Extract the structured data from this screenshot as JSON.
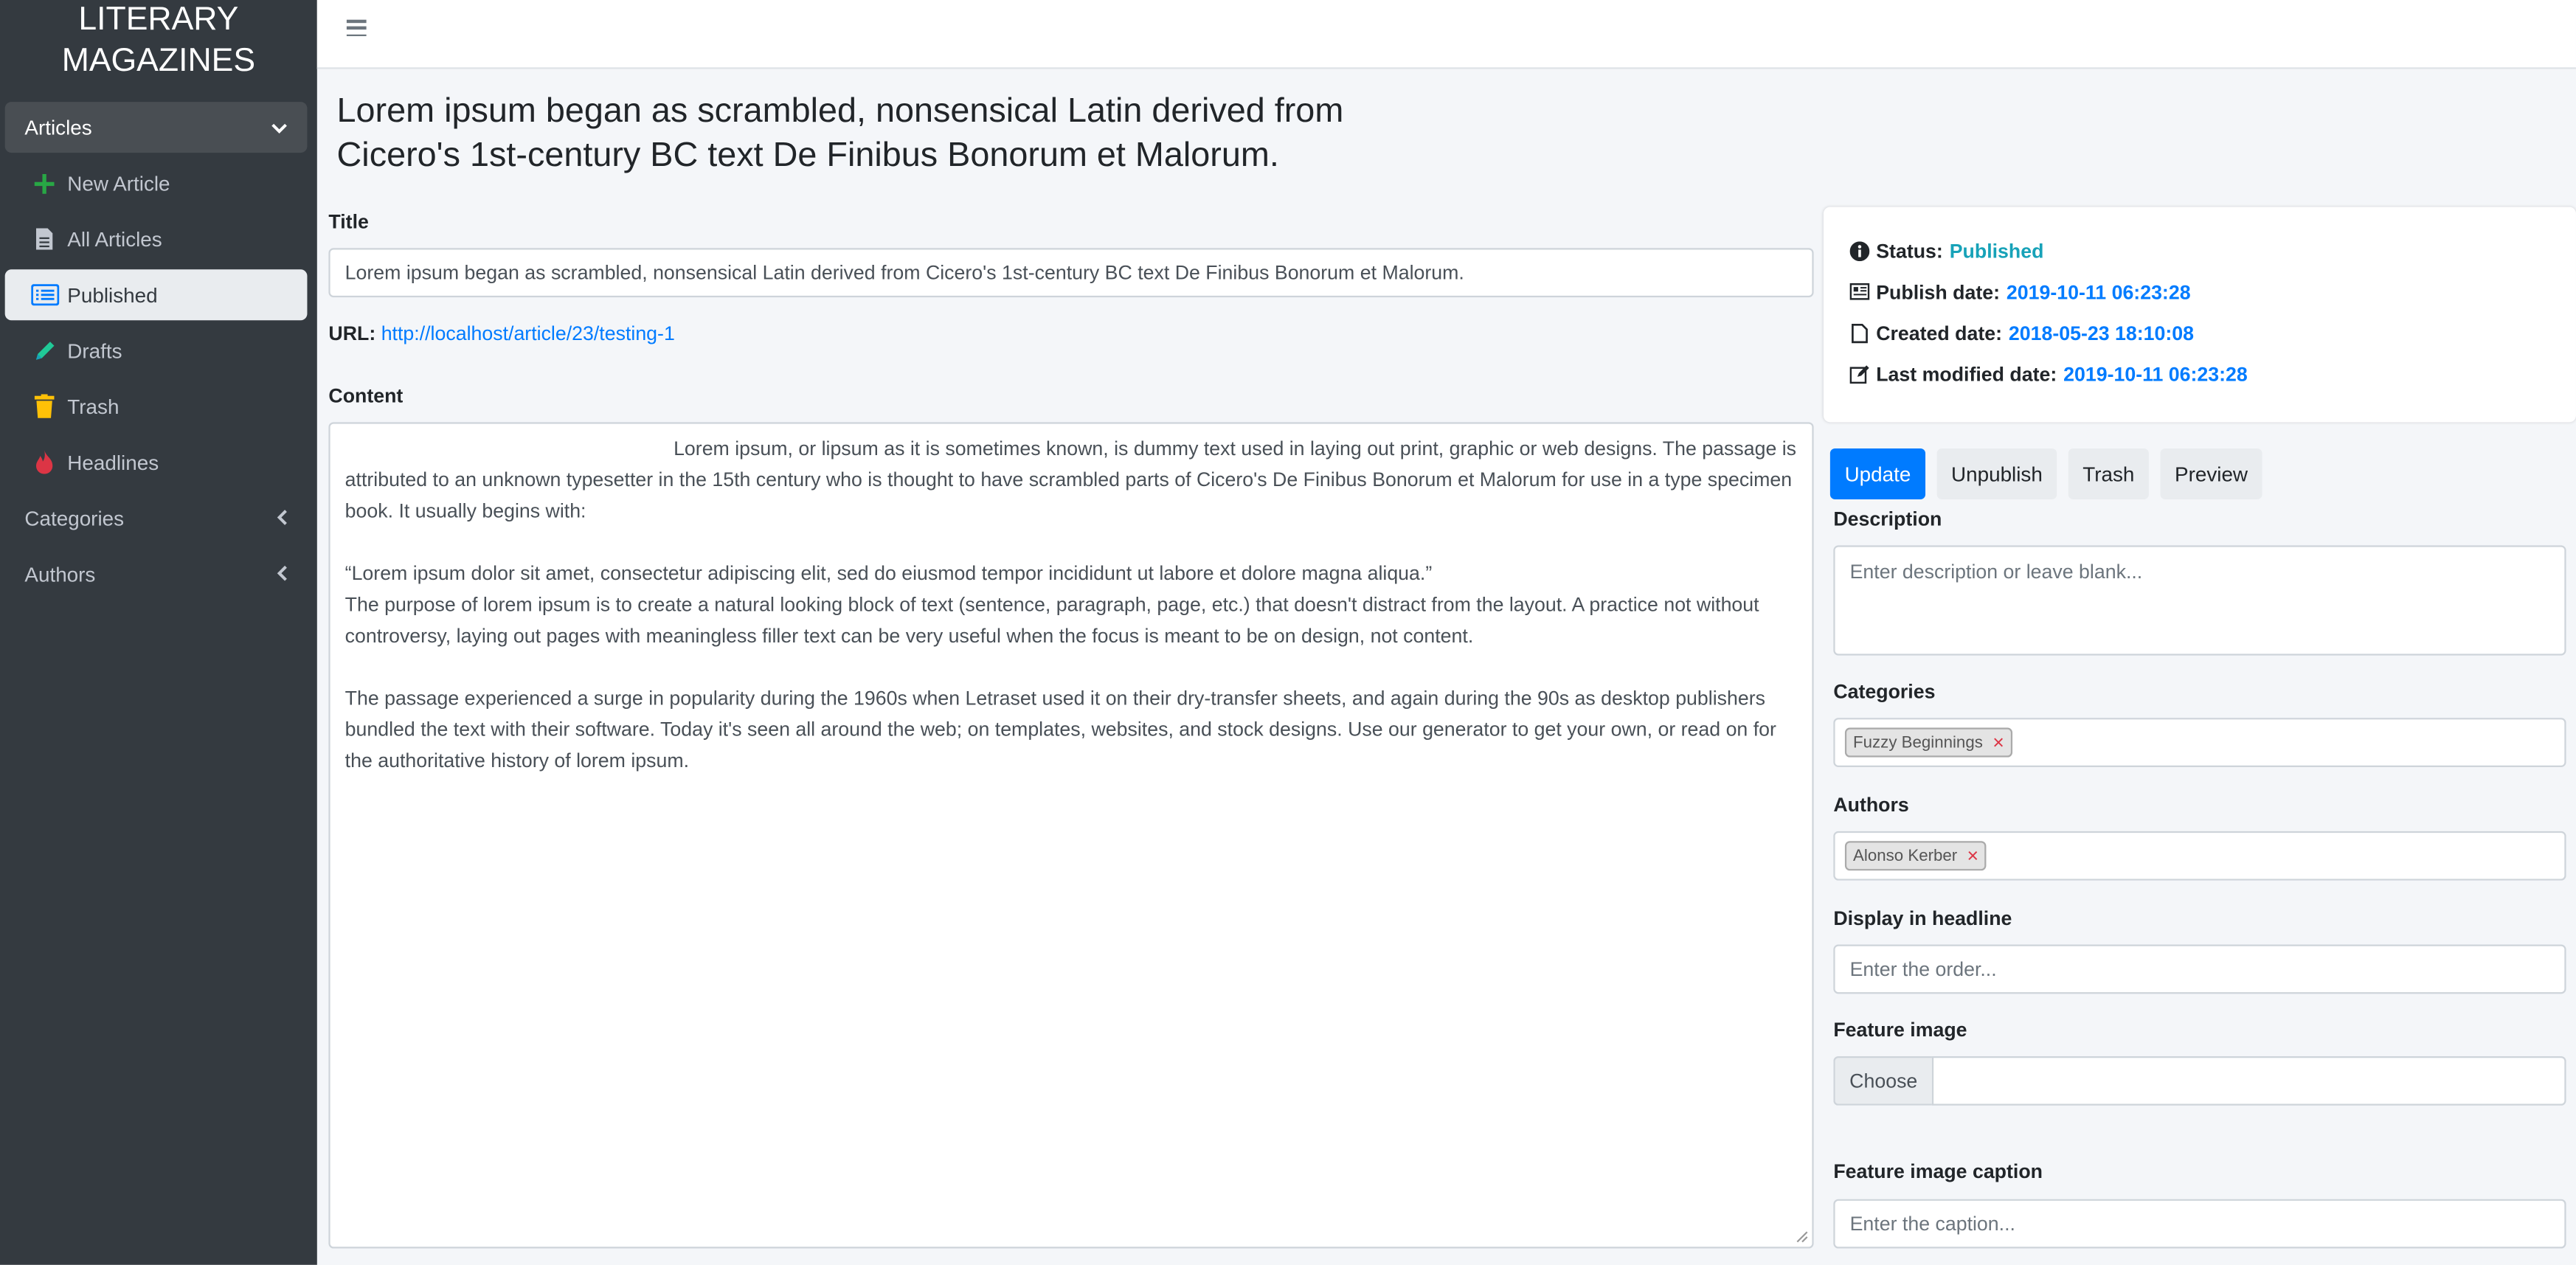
{
  "sidebar": {
    "brand_line1": "LITERARY",
    "brand_line2": "MAGAZINES",
    "group_label": "Articles",
    "items": [
      {
        "label": "New Article",
        "icon": "plus-icon"
      },
      {
        "label": "All Articles",
        "icon": "document-icon"
      },
      {
        "label": "Published",
        "icon": "list-icon"
      },
      {
        "label": "Drafts",
        "icon": "pencil-icon"
      },
      {
        "label": "Trash",
        "icon": "trash-icon"
      },
      {
        "label": "Headlines",
        "icon": "fire-icon"
      }
    ],
    "categories_label": "Categories",
    "authors_label": "Authors"
  },
  "page": {
    "heading": "Lorem ipsum began as scrambled, nonsensical Latin derived from Cicero's 1st-century BC text De Finibus Bonorum et Malorum."
  },
  "form": {
    "title_label": "Title",
    "title_value": "Lorem ipsum began as scrambled, nonsensical Latin derived from Cicero's 1st-century BC text De Finibus Bonorum et Malorum.",
    "url_label": "URL:",
    "url_value": "http://localhost/article/23/testing-1",
    "content_label": "Content",
    "content_p1": "Lorem ipsum, or lipsum as it is sometimes known, is dummy text used in laying out print, graphic or web designs. The passage is attributed to an unknown typesetter in the 15th century who is thought to have scrambled parts of Cicero's De Finibus Bonorum et Malorum for use in a type specimen book. It usually begins with:",
    "content_p2": "“Lorem ipsum dolor sit amet, consectetur adipiscing elit, sed do eiusmod tempor incididunt ut labore et dolore magna aliqua.”",
    "content_p3": "The purpose of lorem ipsum is to create a natural looking block of text (sentence, paragraph, page, etc.) that doesn't distract from the layout. A practice not without controversy, laying out pages with meaningless filler text can be very useful when the focus is meant to be on design, not content.",
    "content_p4": "The passage experienced a surge in popularity during the 1960s when Letraset used it on their dry-transfer sheets, and again during the 90s as desktop publishers bundled the text with their software. Today it's seen all around the web; on templates, websites, and stock designs. Use our generator to get your own, or read on for the authoritative history of lorem ipsum."
  },
  "status": {
    "status_label": "Status:",
    "status_value": "Published",
    "publish_label": "Publish date:",
    "publish_value": "2019-10-11 06:23:28",
    "created_label": "Created date:",
    "created_value": "2018-05-23 18:10:08",
    "modified_label": "Last modified date:",
    "modified_value": "2019-10-11 06:23:28"
  },
  "actions": {
    "update": "Update",
    "unpublish": "Unpublish",
    "trash": "Trash",
    "preview": "Preview"
  },
  "side_form": {
    "description_label": "Description",
    "description_placeholder": "Enter description or leave blank...",
    "categories_label": "Categories",
    "category_tag": "Fuzzy Beginnings",
    "authors_label": "Authors",
    "author_tag": "Alonso Kerber",
    "headline_label": "Display in headline",
    "headline_placeholder": "Enter the order...",
    "feature_image_label": "Feature image",
    "choose_label": "Choose",
    "caption_label": "Feature image caption",
    "caption_placeholder": "Enter the caption..."
  },
  "colors": {
    "sidebar_bg": "#343a40",
    "primary": "#007bff",
    "teal": "#17a2b8"
  }
}
